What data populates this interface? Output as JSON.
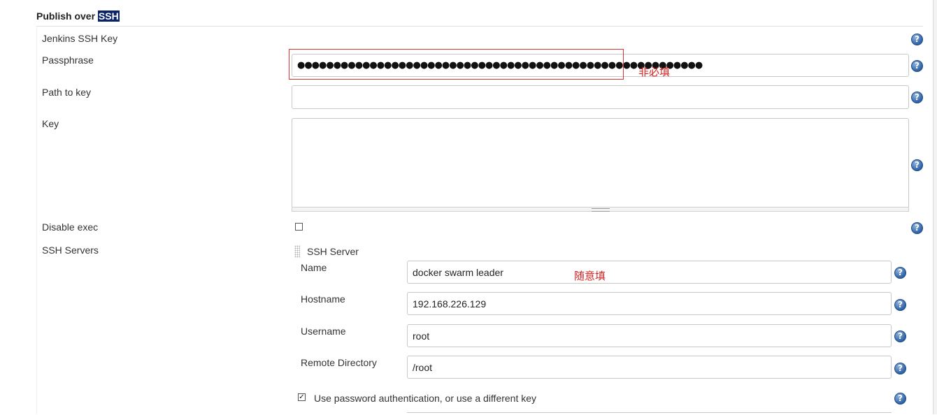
{
  "section": {
    "title_prefix": "Publish over ",
    "title_highlight": "SSH"
  },
  "fields": {
    "jenkins_ssh_key_label": "Jenkins SSH Key",
    "passphrase_label": "Passphrase",
    "passphrase_value": "●●●●●●●●●●●●●●●●●●●●●●●●●●●●●●●●●●●●●●●●●●●●●●●●●●●●●●●●",
    "path_to_key_label": "Path to key",
    "path_to_key_value": "",
    "key_label": "Key",
    "key_value": "",
    "disable_exec_label": "Disable exec",
    "disable_exec_checked": false,
    "ssh_servers_label": "SSH Servers"
  },
  "ssh_server": {
    "heading": "SSH Server",
    "name_label": "Name",
    "name_value": "docker swarm leader",
    "hostname_label": "Hostname",
    "hostname_value": "192.168.226.129",
    "username_label": "Username",
    "username_value": "root",
    "remote_dir_label": "Remote Directory",
    "remote_dir_value": "/root",
    "use_password_label": "Use password authentication, or use a different key",
    "use_password_checked": true,
    "checkbox_checked_glyph": "✓"
  },
  "annotations": {
    "passphrase_note": "非必填",
    "name_note": "随意填"
  },
  "help_icon_glyph": "?",
  "colors": {
    "annotation_red": "#d32323",
    "help_blue": "#2f62a6",
    "highlight_navy": "#0a246a"
  }
}
